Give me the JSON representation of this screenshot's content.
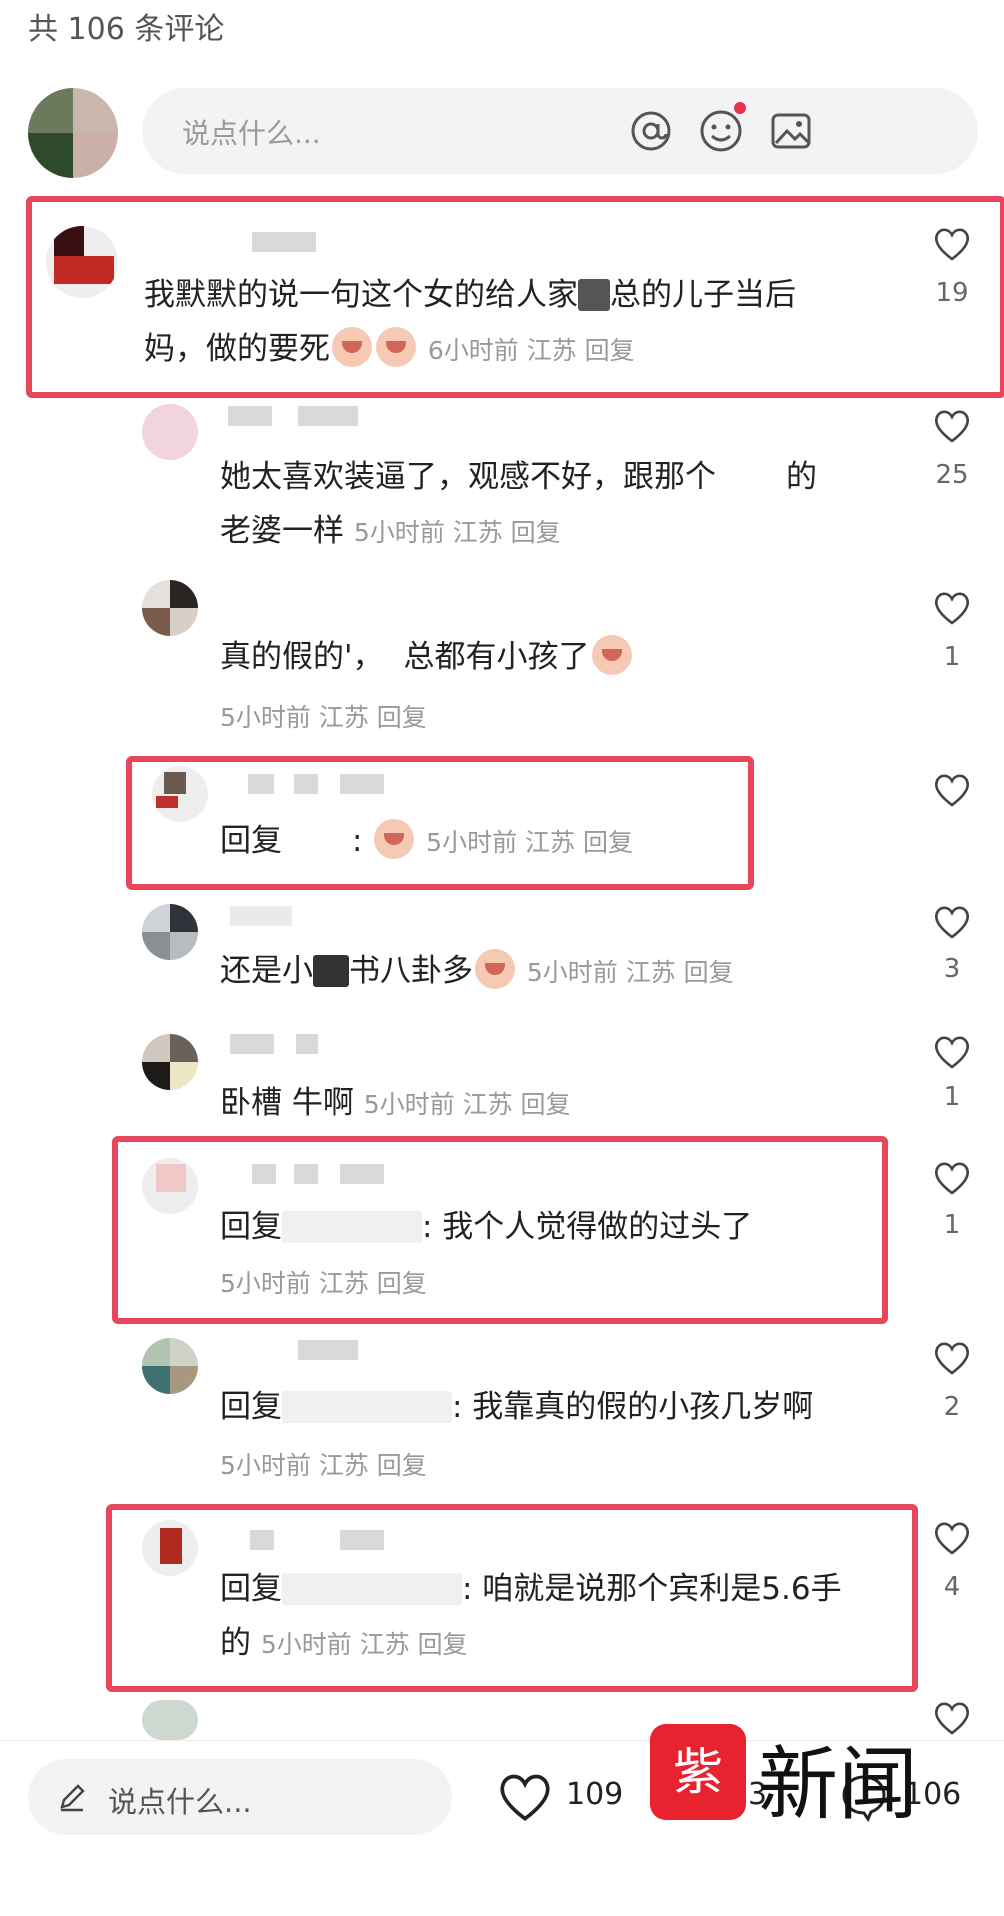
{
  "header": {
    "count": "共 106 条评论"
  },
  "input": {
    "placeholder": "说点什么...",
    "icons": [
      "at-icon",
      "emoji-icon",
      "image-icon"
    ]
  },
  "comments": [
    {
      "text1": "我默默的说一句这个女的给人家",
      "text1b": "总的儿子当后",
      "text2": "妈，做的要死",
      "meta": "6小时前 江苏 回复",
      "likes": "19"
    },
    {
      "text1": "她太喜欢装逼了，观感不好，跟那个",
      "text1b": "的",
      "text2": "老婆一样",
      "meta": "5小时前 江苏 回复",
      "likes": "25"
    },
    {
      "text1": "真的假的'，",
      "text1b": "总都有小孩了",
      "meta": "5小时前 江苏 回复",
      "likes": "1"
    },
    {
      "prefix": "回复",
      "text1b": ":",
      "meta": "5小时前 江苏 回复",
      "likes": ""
    },
    {
      "text1": "还是小",
      "text1b": "书八卦多",
      "meta": "5小时前 江苏 回复",
      "likes": "3"
    },
    {
      "text1": "卧槽 牛啊",
      "meta": "5小时前 江苏 回复",
      "likes": "1"
    },
    {
      "prefix": "回复",
      "text1b": ": 我个人觉得做的过头了",
      "meta": "5小时前 江苏 回复",
      "likes": "1"
    },
    {
      "prefix": "回复",
      "text1b": ": 我靠真的假的小孩几岁啊",
      "meta": "5小时前 江苏 回复",
      "likes": "2"
    },
    {
      "prefix": "回复",
      "text1b": ": 咱就是说那个宾利是5.6手",
      "text2": "的",
      "meta": "5小时前 江苏 回复",
      "likes": "4"
    }
  ],
  "bottom": {
    "placeholder": "说点什么...",
    "likes": "109",
    "collects": "3",
    "comments": "106"
  },
  "watermark": {
    "logo": "紫牛",
    "text": "新闻"
  },
  "colors": {
    "highlight": "#e8465a",
    "meta": "#999999",
    "accent": "#e6334a"
  }
}
